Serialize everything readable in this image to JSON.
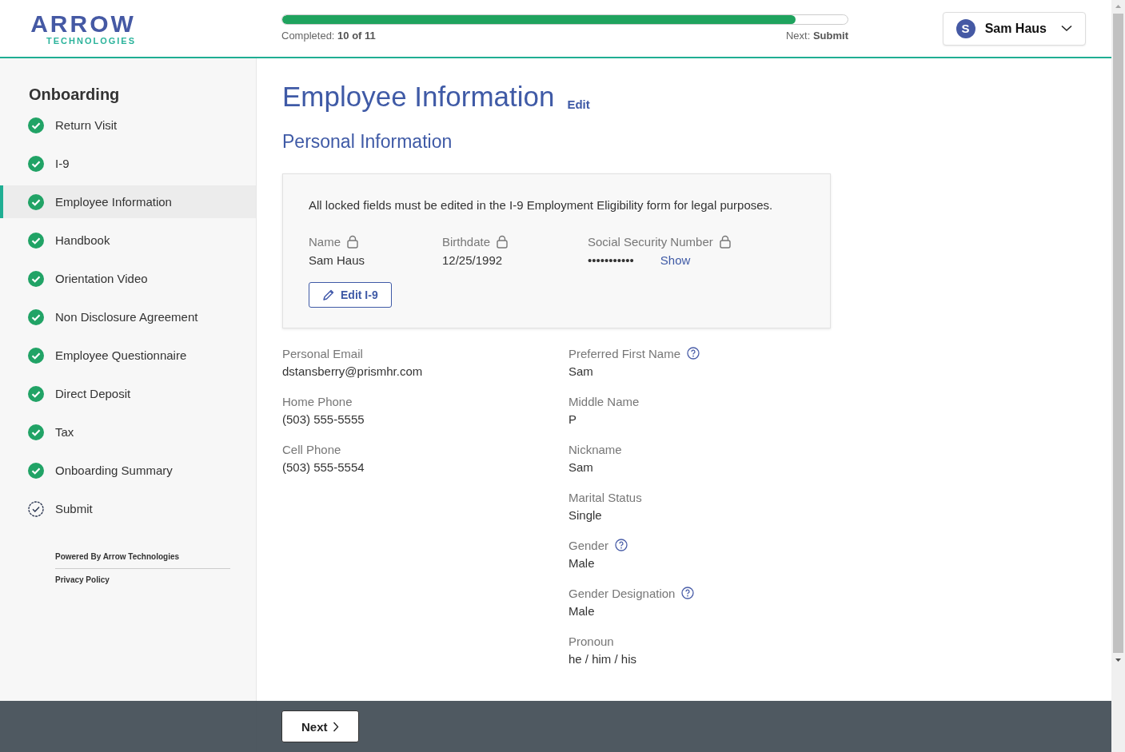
{
  "logo": {
    "word": "ARROW",
    "tagline": "TECHNOLOGIES"
  },
  "progress": {
    "completed_label": "Completed:",
    "completed_value": "10 of 11",
    "next_label": "Next:",
    "next_value": "Submit",
    "level": 0.908
  },
  "user_menu": {
    "initial": "S",
    "name": "Sam Haus"
  },
  "sidebar": {
    "title": "Onboarding",
    "items": [
      {
        "label": "Return Visit",
        "kind": "done",
        "selected": false
      },
      {
        "label": "I-9",
        "kind": "done",
        "selected": false
      },
      {
        "label": "Employee Information",
        "kind": "done",
        "selected": true
      },
      {
        "label": "Handbook",
        "kind": "done",
        "selected": false
      },
      {
        "label": "Orientation Video",
        "kind": "done",
        "selected": false
      },
      {
        "label": "Non Disclosure Agreement",
        "kind": "done",
        "selected": false
      },
      {
        "label": "Employee Questionnaire",
        "kind": "done",
        "selected": false
      },
      {
        "label": "Direct Deposit",
        "kind": "done",
        "selected": false
      },
      {
        "label": "Tax",
        "kind": "done",
        "selected": false
      },
      {
        "label": "Onboarding Summary",
        "kind": "done",
        "selected": false
      },
      {
        "label": "Submit",
        "kind": "pending",
        "selected": false
      }
    ],
    "powered_by": "Powered By  Arrow Technologies",
    "privacy": "Privacy Policy"
  },
  "page": {
    "title": "Employee Information",
    "edit_link": "Edit",
    "section": "Personal Information"
  },
  "locked_card": {
    "notice": "All locked fields must be edited in the I-9 Employment Eligibility form for legal purposes.",
    "fields": [
      {
        "label": "Name",
        "value": "Sam Haus"
      },
      {
        "label": "Birthdate",
        "value": "12/25/1992"
      },
      {
        "label": "Social Security Number",
        "value": "•••••••••••",
        "action": "Show"
      }
    ],
    "button": "Edit I-9"
  },
  "left_fields": [
    {
      "label": "Personal Email",
      "value": "dstansberry@prismhr.com",
      "help": false
    },
    {
      "label": "Home Phone",
      "value": "(503) 555-5555",
      "help": false
    },
    {
      "label": "Cell Phone",
      "value": "(503) 555-5554",
      "help": false
    }
  ],
  "right_fields": [
    {
      "label": "Preferred First Name",
      "value": "Sam",
      "help": true
    },
    {
      "label": "Middle Name",
      "value": "P",
      "help": false
    },
    {
      "label": "Nickname",
      "value": "Sam",
      "help": false
    },
    {
      "label": "Marital Status",
      "value": "Single",
      "help": false
    },
    {
      "label": "Gender",
      "value": "Male",
      "help": true
    },
    {
      "label": "Gender Designation",
      "value": "Male",
      "help": true
    },
    {
      "label": "Pronoun",
      "value": "he / him / his",
      "help": false
    }
  ],
  "footer": {
    "next_button": "Next"
  }
}
